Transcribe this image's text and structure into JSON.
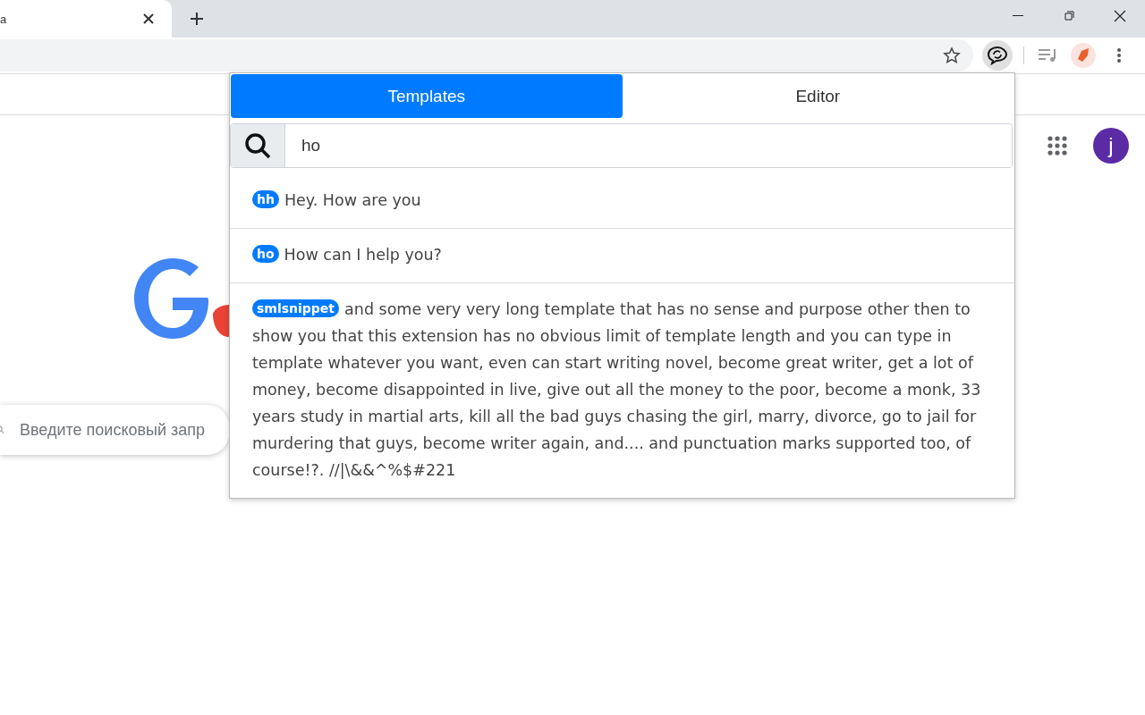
{
  "browser": {
    "tab_title": "a"
  },
  "page": {
    "search": {
      "placeholder": "Введите поисковый запр"
    },
    "avatar": "j"
  },
  "popup": {
    "tabs": [
      {
        "label": "Templates",
        "selected": true
      },
      {
        "label": "Editor",
        "selected": false
      }
    ],
    "search": {
      "value": "ho"
    },
    "templates": [
      {
        "shortcut": "hh",
        "text": "Hey. How are you"
      },
      {
        "shortcut": "ho",
        "text": "How can I help you?"
      },
      {
        "shortcut": "smlsnippet",
        "text": "and some very very long template that has no sense and purpose other then to show you that this extension has no obvious limit of template length and you can type in template whatever you want, even can start writing novel, become great writer, get a lot of money, become disappointed in live, give out all the money to the poor, become a monk, 33 years study in martial arts, kill all the bad guys chasing the girl, marry, divorce, go to jail for murdering that guys, become writer again, and.... and punctuation marks supported too, of course!?. //|\\&&^%$#221"
      }
    ]
  }
}
